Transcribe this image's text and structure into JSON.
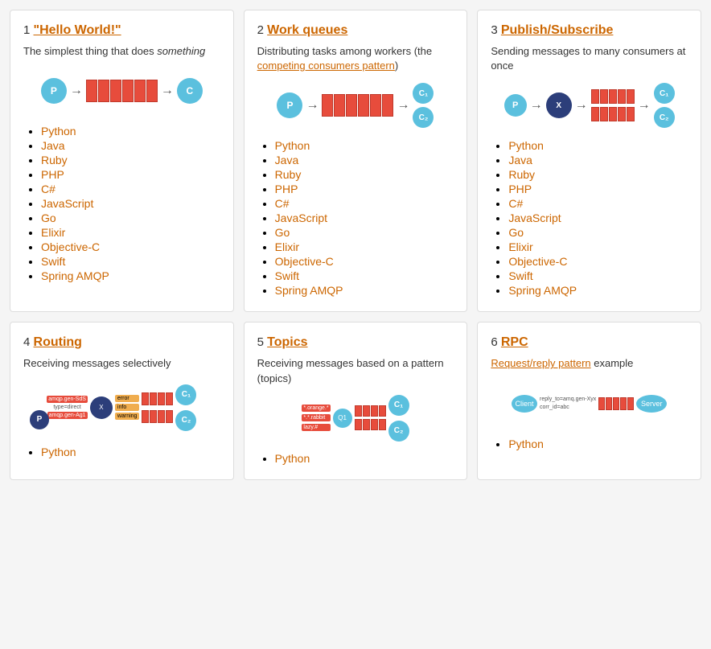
{
  "cards": [
    {
      "number": "1",
      "title": "\"Hello World!\"",
      "title_href": "#",
      "desc_plain": "The simplest thing that does ",
      "desc_em": "something",
      "diagram_type": "diag1",
      "links": [
        {
          "label": "Python",
          "href": "#"
        },
        {
          "label": "Java",
          "href": "#"
        },
        {
          "label": "Ruby",
          "href": "#"
        },
        {
          "label": "PHP",
          "href": "#"
        },
        {
          "label": "C#",
          "href": "#"
        },
        {
          "label": "JavaScript",
          "href": "#"
        },
        {
          "label": "Go",
          "href": "#"
        },
        {
          "label": "Elixir",
          "href": "#"
        },
        {
          "label": "Objective-C",
          "href": "#"
        },
        {
          "label": "Swift",
          "href": "#"
        },
        {
          "label": "Spring AMQP",
          "href": "#"
        }
      ]
    },
    {
      "number": "2",
      "title": "Work queues",
      "title_href": "#",
      "desc_plain": "Distributing tasks among workers (the ",
      "desc_link_text": "competing consumers pattern",
      "desc_link_href": "#",
      "desc_suffix": ")",
      "diagram_type": "diag2",
      "links": [
        {
          "label": "Python",
          "href": "#"
        },
        {
          "label": "Java",
          "href": "#"
        },
        {
          "label": "Ruby",
          "href": "#"
        },
        {
          "label": "PHP",
          "href": "#"
        },
        {
          "label": "C#",
          "href": "#"
        },
        {
          "label": "JavaScript",
          "href": "#"
        },
        {
          "label": "Go",
          "href": "#"
        },
        {
          "label": "Elixir",
          "href": "#"
        },
        {
          "label": "Objective-C",
          "href": "#"
        },
        {
          "label": "Swift",
          "href": "#"
        },
        {
          "label": "Spring AMQP",
          "href": "#"
        }
      ]
    },
    {
      "number": "3",
      "title": "Publish/Subscribe",
      "title_href": "#",
      "desc_plain": "Sending messages to many consumers at once",
      "diagram_type": "diag3",
      "links": [
        {
          "label": "Python",
          "href": "#"
        },
        {
          "label": "Java",
          "href": "#"
        },
        {
          "label": "Ruby",
          "href": "#"
        },
        {
          "label": "PHP",
          "href": "#"
        },
        {
          "label": "C#",
          "href": "#"
        },
        {
          "label": "JavaScript",
          "href": "#"
        },
        {
          "label": "Go",
          "href": "#"
        },
        {
          "label": "Elixir",
          "href": "#"
        },
        {
          "label": "Objective-C",
          "href": "#"
        },
        {
          "label": "Swift",
          "href": "#"
        },
        {
          "label": "Spring AMQP",
          "href": "#"
        }
      ]
    },
    {
      "number": "4",
      "title": "Routing",
      "title_href": "#",
      "desc_plain": "Receiving messages selectively",
      "diagram_type": "diag4",
      "links": [
        {
          "label": "Python",
          "href": "#"
        }
      ]
    },
    {
      "number": "5",
      "title": "Topics",
      "title_href": "#",
      "desc_plain": "Receiving messages based on a pattern (topics)",
      "diagram_type": "diag5",
      "links": [
        {
          "label": "Python",
          "href": "#"
        }
      ]
    },
    {
      "number": "6",
      "title": "RPC",
      "title_href": "#",
      "desc_plain": "example",
      "desc_link_text": "Request/reply pattern",
      "desc_link_href": "#",
      "diagram_type": "diag6",
      "links": [
        {
          "label": "Python",
          "href": "#"
        }
      ]
    }
  ]
}
